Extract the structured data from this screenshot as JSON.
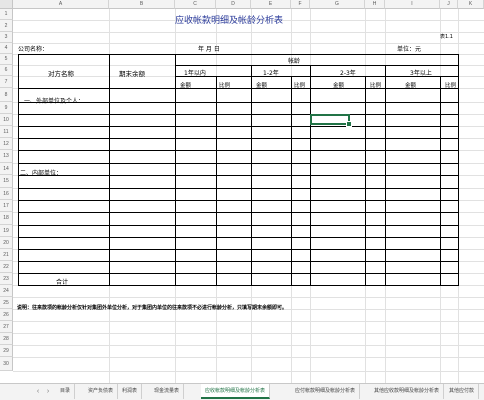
{
  "sheet": {
    "title": "应收帐款明细及帐龄分析表",
    "table_no": "表1.1",
    "company_label": "公司名称：",
    "date_label": "年    月    日",
    "unit_label": "单位：元",
    "headers": {
      "counterparty": "对方名称",
      "ending_balance": "期末余额",
      "aging": "帐龄",
      "within_1y": "1年以内",
      "y1_2": "1-2年",
      "y2_3": "2-3年",
      "over_3y": "3年以上",
      "amount": "金额",
      "ratio": "比例"
    },
    "section_external": "一、外部单位及个人：",
    "section_internal": "二、内部单位：",
    "total_label": "合计",
    "note": "说明：往来款项的帐龄分析仅针对集团外单位分析，对于集团内单位的往来款项不必进行帐龄分析，只填写期末余额即可。"
  },
  "grid": {
    "column_letters": [
      "A",
      "B",
      "C",
      "D",
      "E",
      "F",
      "G",
      "H",
      "I",
      "J",
      "K"
    ],
    "row_numbers": [
      "1",
      "2",
      "3",
      "4",
      "5",
      "6",
      "7",
      "8",
      "9",
      "10",
      "11",
      "12",
      "13",
      "14",
      "15",
      "16",
      "17",
      "18",
      "19",
      "20",
      "21",
      "22",
      "23",
      "24",
      "25",
      "26",
      "27",
      "28",
      "29",
      "30"
    ]
  },
  "tabs": {
    "items": [
      "目录",
      "资产负债表",
      "利润表",
      "现金流量表",
      "应收帐款明细及帐龄分析表",
      "应付帐款明细及帐龄分析表",
      "其他应收款明细及帐龄分析表",
      "其他应付款"
    ],
    "active_index": 4
  },
  "colors": {
    "accent": "#217346"
  }
}
